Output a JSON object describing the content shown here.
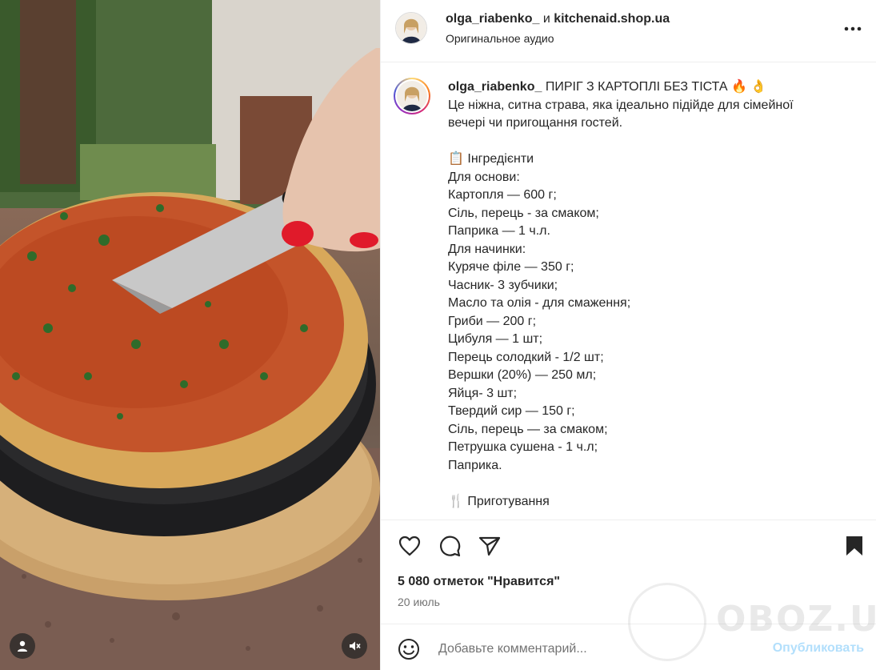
{
  "post": {
    "author": "olga_riabenko_",
    "joiner": " и ",
    "coauthor": "kitchenaid.shop.ua",
    "audio": "Оригинальное аудио"
  },
  "caption": {
    "username": "olga_riabenko_",
    "title": " ПИРІГ З КАРТОПЛІ БЕЗ ТІСТА 🔥 👌",
    "lines": [
      "Це ніжна, ситна страва, яка ідеально підійде для сімейної",
      "вечері чи пригощання гостей.",
      "",
      "📋 Інгредієнти",
      "Для основи:",
      "Картопля — 600 г;",
      "Сіль, перець - за смаком;",
      "Паприка — 1 ч.л.",
      "Для начинки:",
      "Куряче філе — 350 г;",
      "Часник- 3 зубчики;",
      "Масло та олія - для смаження;",
      "Гриби — 200 г;",
      "Цибуля — 1 шт;",
      "Перець солодкий - 1/2 шт;",
      "Вершки (20%) — 250 мл;",
      "Яйця- 3 шт;",
      "Твердий сир — 150 г;",
      "Сіль, перець — за смаком;",
      "Петрушка сушена - 1 ч.л;",
      "Паприка.",
      "",
      "🍴 Приготування"
    ]
  },
  "stats": {
    "likes": "5 080 отметок \"Нравится\"",
    "date": "20 июль"
  },
  "comment": {
    "placeholder": "Добавьте комментарий...",
    "publish": "Опубликовать"
  },
  "watermark": {
    "text": "OBOZ.UA"
  },
  "icons": {
    "like": "heart-icon",
    "comment": "comment-icon",
    "share": "share-icon",
    "save": "bookmark-icon",
    "more": "more-icon",
    "emoji": "emoji-icon",
    "sound": "mute-icon",
    "user": "user-icon"
  },
  "colors": {
    "publish_disabled": "#b2dffc",
    "secondary_text": "#737373",
    "divider": "#efefef"
  }
}
